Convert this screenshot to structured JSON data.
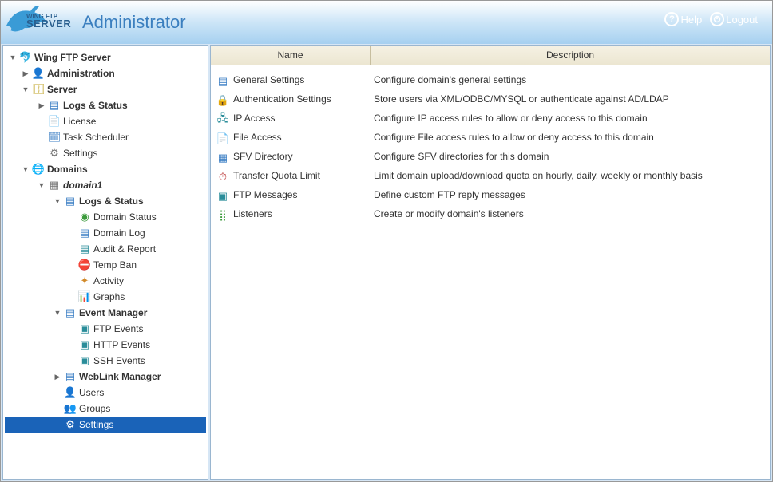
{
  "header": {
    "brand_small1": "WING FTP",
    "brand_small2": "SERVER",
    "title": "Administrator",
    "help": "Help",
    "logout": "Logout"
  },
  "tree": {
    "root": "Wing FTP Server",
    "administration": "Administration",
    "server": "Server",
    "server_children": {
      "logs_status": "Logs & Status",
      "license": "License",
      "task_scheduler": "Task Scheduler",
      "settings": "Settings"
    },
    "domains": "Domains",
    "domain1": "domain1",
    "d_logs_status": "Logs & Status",
    "d_logs_children": {
      "domain_status": "Domain Status",
      "domain_log": "Domain Log",
      "audit_report": "Audit & Report",
      "temp_ban": "Temp Ban",
      "activity": "Activity",
      "graphs": "Graphs"
    },
    "event_manager": "Event Manager",
    "event_children": {
      "ftp": "FTP Events",
      "http": "HTTP Events",
      "ssh": "SSH Events"
    },
    "weblink": "WebLink Manager",
    "d_tail": {
      "users": "Users",
      "groups": "Groups",
      "settings": "Settings"
    }
  },
  "table": {
    "col_name": "Name",
    "col_desc": "Description",
    "rows": [
      {
        "name": "General Settings",
        "desc": "Configure domain's general settings"
      },
      {
        "name": "Authentication Settings",
        "desc": "Store users via XML/ODBC/MYSQL or authenticate against AD/LDAP"
      },
      {
        "name": "IP Access",
        "desc": "Configure IP access rules to allow or deny access to this domain"
      },
      {
        "name": "File Access",
        "desc": "Configure File access rules to allow or deny access to this domain"
      },
      {
        "name": "SFV Directory",
        "desc": "Configure SFV directories for this domain"
      },
      {
        "name": "Transfer Quota Limit",
        "desc": "Limit domain upload/download quota on hourly, daily, weekly or monthly basis"
      },
      {
        "name": "FTP Messages",
        "desc": "Define custom FTP reply messages"
      },
      {
        "name": "Listeners",
        "desc": "Create or modify domain's listeners"
      }
    ]
  }
}
